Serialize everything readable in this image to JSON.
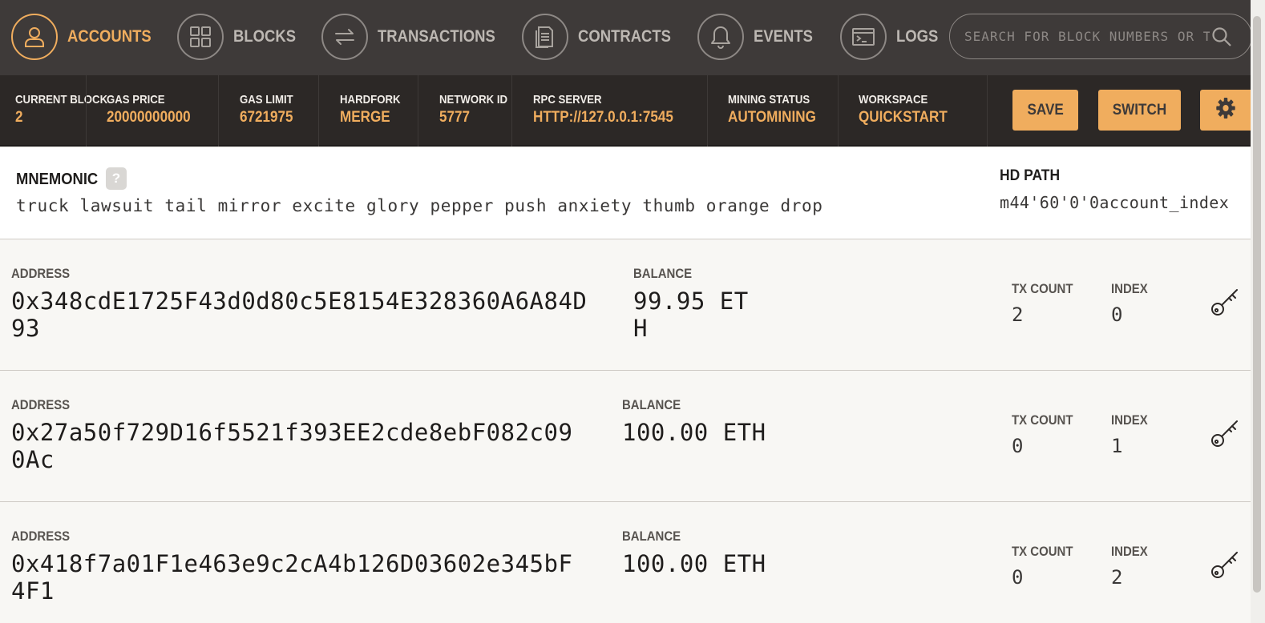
{
  "nav": {
    "items": [
      {
        "label": "ACCOUNTS",
        "icon": "person-icon",
        "active": true
      },
      {
        "label": "BLOCKS",
        "icon": "grid-icon",
        "active": false
      },
      {
        "label": "TRANSACTIONS",
        "icon": "swap-arrows-icon",
        "active": false
      },
      {
        "label": "CONTRACTS",
        "icon": "document-icon",
        "active": false
      },
      {
        "label": "EVENTS",
        "icon": "bell-icon",
        "active": false
      },
      {
        "label": "LOGS",
        "icon": "terminal-icon",
        "active": false
      }
    ],
    "search_placeholder": "SEARCH FOR BLOCK NUMBERS OR TX HASHES"
  },
  "status": {
    "current_block": {
      "label": "CURRENT BLOCK",
      "value": "2"
    },
    "gas_price": {
      "label": "GAS PRICE",
      "value": "20000000000"
    },
    "gas_limit": {
      "label": "GAS LIMIT",
      "value": "6721975"
    },
    "hardfork": {
      "label": "HARDFORK",
      "value": "MERGE"
    },
    "network_id": {
      "label": "NETWORK ID",
      "value": "5777"
    },
    "rpc_server": {
      "label": "RPC SERVER",
      "value": "HTTP://127.0.0.1:7545"
    },
    "mining_status": {
      "label": "MINING STATUS",
      "value": "AUTOMINING"
    },
    "workspace": {
      "label": "WORKSPACE",
      "value": "QUICKSTART"
    },
    "save_label": "SAVE",
    "switch_label": "SWITCH"
  },
  "mnemonic": {
    "title": "MNEMONIC",
    "help": "?",
    "words": "truck lawsuit tail mirror excite glory pepper push anxiety thumb orange drop",
    "hd_path_title": "HD PATH",
    "hd_path_value": "m44'60'0'0account_index"
  },
  "accounts": [
    {
      "address_label": "ADDRESS",
      "address": "0x348cdE1725F43d0d80c5E8154E328360A6A84D93",
      "balance_label": "BALANCE",
      "balance": "99.95 ETH",
      "tx_label": "TX COUNT",
      "tx_count": "2",
      "index_label": "INDEX",
      "index": "0"
    },
    {
      "address_label": "ADDRESS",
      "address": "0x27a50f729D16f5521f393EE2cde8ebF082c090Ac",
      "balance_label": "BALANCE",
      "balance": "100.00 ETH",
      "tx_label": "TX COUNT",
      "tx_count": "0",
      "index_label": "INDEX",
      "index": "1"
    },
    {
      "address_label": "ADDRESS",
      "address": "0x418f7a01F1e463e9c2cA4b126D03602e345bF4F1",
      "balance_label": "BALANCE",
      "balance": "100.00 ETH",
      "tx_label": "TX COUNT",
      "tx_count": "0",
      "index_label": "INDEX",
      "index": "2"
    }
  ],
  "colors": {
    "accent": "#f0ad5e",
    "nav_bg": "#3e3a39",
    "status_bg": "#2c2826",
    "row_bg": "#f8f7f4"
  }
}
